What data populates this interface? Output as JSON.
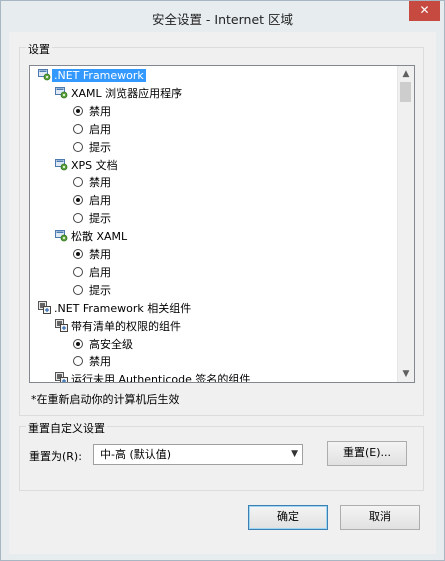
{
  "window": {
    "title": "安全设置 - Internet 区域",
    "close_glyph": "✕"
  },
  "settings_group": {
    "label": "设置"
  },
  "tree": [
    {
      "type": "node",
      "icon": "settings-node-icon",
      "label": ".NET Framework",
      "selected": true,
      "level": 0
    },
    {
      "type": "node",
      "icon": "settings-node-icon",
      "label": "XAML 浏览器应用程序",
      "level": 1
    },
    {
      "type": "radio",
      "label": "禁用",
      "checked": true,
      "level": 2
    },
    {
      "type": "radio",
      "label": "启用",
      "checked": false,
      "level": 2
    },
    {
      "type": "radio",
      "label": "提示",
      "checked": false,
      "level": 2
    },
    {
      "type": "node",
      "icon": "settings-node-icon",
      "label": "XPS 文档",
      "level": 1
    },
    {
      "type": "radio",
      "label": "禁用",
      "checked": false,
      "level": 2
    },
    {
      "type": "radio",
      "label": "启用",
      "checked": true,
      "level": 2
    },
    {
      "type": "radio",
      "label": "提示",
      "checked": false,
      "level": 2
    },
    {
      "type": "node",
      "icon": "settings-node-icon",
      "label": "松散 XAML",
      "level": 1
    },
    {
      "type": "radio",
      "label": "禁用",
      "checked": true,
      "level": 2
    },
    {
      "type": "radio",
      "label": "启用",
      "checked": false,
      "level": 2
    },
    {
      "type": "radio",
      "label": "提示",
      "checked": false,
      "level": 2
    },
    {
      "type": "node",
      "icon": "component-node-icon",
      "label": ".NET Framework 相关组件",
      "level": 0
    },
    {
      "type": "node",
      "icon": "component-node-icon",
      "label": "带有清单的权限的组件",
      "level": 1
    },
    {
      "type": "radio",
      "label": "高安全级",
      "checked": true,
      "level": 2
    },
    {
      "type": "radio",
      "label": "禁用",
      "checked": false,
      "level": 2
    },
    {
      "type": "node",
      "icon": "component-node-icon",
      "label": "运行未用 Authenticode 签名的组件",
      "level": 1
    }
  ],
  "restart_note": "*在重新启动你的计算机后生效",
  "reset_group": {
    "label": "重置自定义设置",
    "reset_to_label": "重置为(R):",
    "selected_level": "中-高 (默认值)",
    "reset_button": "重置(E)..."
  },
  "buttons": {
    "ok": "确定",
    "cancel": "取消"
  },
  "colors": {
    "selection": "#3399ff",
    "close_button": "#c74a41"
  }
}
